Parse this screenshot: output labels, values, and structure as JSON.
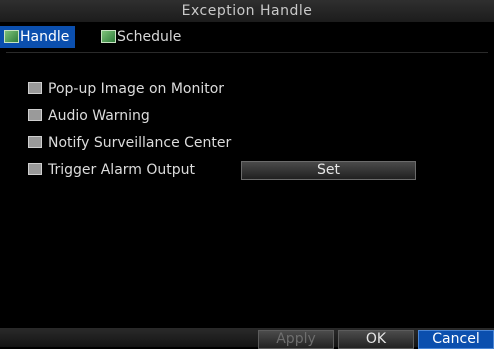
{
  "window": {
    "title": "Exception Handle"
  },
  "tabs": [
    {
      "label": "Handle",
      "active": true,
      "icon": "tab-icon"
    },
    {
      "label": "Schedule",
      "active": false,
      "icon": "tab-icon"
    }
  ],
  "options": [
    {
      "label": "Pop-up Image on Monitor",
      "checked": false
    },
    {
      "label": "Audio Warning",
      "checked": false
    },
    {
      "label": "Notify Surveillance Center",
      "checked": false
    },
    {
      "label": "Trigger Alarm Output",
      "checked": false
    }
  ],
  "set_button": {
    "label": "Set"
  },
  "buttons": {
    "apply": "Apply",
    "ok": "OK",
    "cancel": "Cancel"
  },
  "colors": {
    "accent": "#0b4fae",
    "background": "#000000",
    "text": "#dcdcdc"
  }
}
